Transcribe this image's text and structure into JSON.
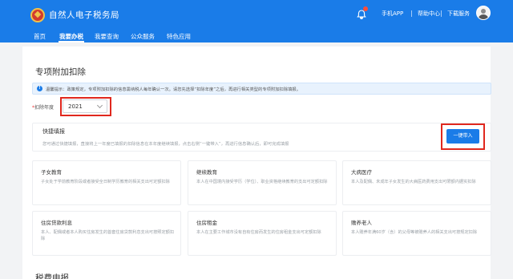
{
  "header": {
    "brand": "自然人电子税务局",
    "links": [
      "手机APP",
      "帮助中心",
      "下载服务"
    ],
    "nav": [
      {
        "label": "首页",
        "active": false
      },
      {
        "label": "我要办税",
        "active": true
      },
      {
        "label": "我要查询",
        "active": false
      },
      {
        "label": "公众服务",
        "active": false
      },
      {
        "label": "特色应用",
        "active": false
      }
    ],
    "colors": {
      "primary": "#1a7ce8",
      "highlight": "#e0281e"
    }
  },
  "page": {
    "title": "专项附加扣除",
    "notice": "温馨提示：政策规定，专项附加扣除的信息需纳税人每年确认一次。请您先选择“扣除年度”之后，再进行相关类型的专项附加扣除填报。",
    "year_label": "扣除年度",
    "year_required": "*",
    "year_value": "2021",
    "quick": {
      "title": "快捷填报",
      "desc": "您可通过快捷填报，直接将上一年度已填报的扣除信息在本年度继续填报，点击右侧“一键带入”，再进行信息确认后，即可完成填报",
      "button": "一键带入"
    },
    "cards": [
      {
        "title": "子女教育",
        "desc": "子女处于学前教育阶段或者接受全日制学历教育的相关支出可定额扣除"
      },
      {
        "title": "继续教育",
        "desc": "本人在中国境内接受学历（学位）、职业资格继续教育的支出可定额扣除"
      },
      {
        "title": "大病医疗",
        "desc": "本人及配偶、未成年子女发生的大病医药费用支出可限额内据实扣除"
      },
      {
        "title": "住房贷款利息",
        "desc": "本人、配偶或者本人购买住房发生的首套住房贷款利息支出可按照定额扣除"
      },
      {
        "title": "住房租金",
        "desc": "本人在主要工作城市没有自有住房而发生的住房租金支出可定额扣除"
      },
      {
        "title": "赡养老人",
        "desc": "本人赡养年满60岁（含）的父母等被赡养人的相关支出可按规定扣除"
      }
    ],
    "next_section_title": "税费申报"
  }
}
